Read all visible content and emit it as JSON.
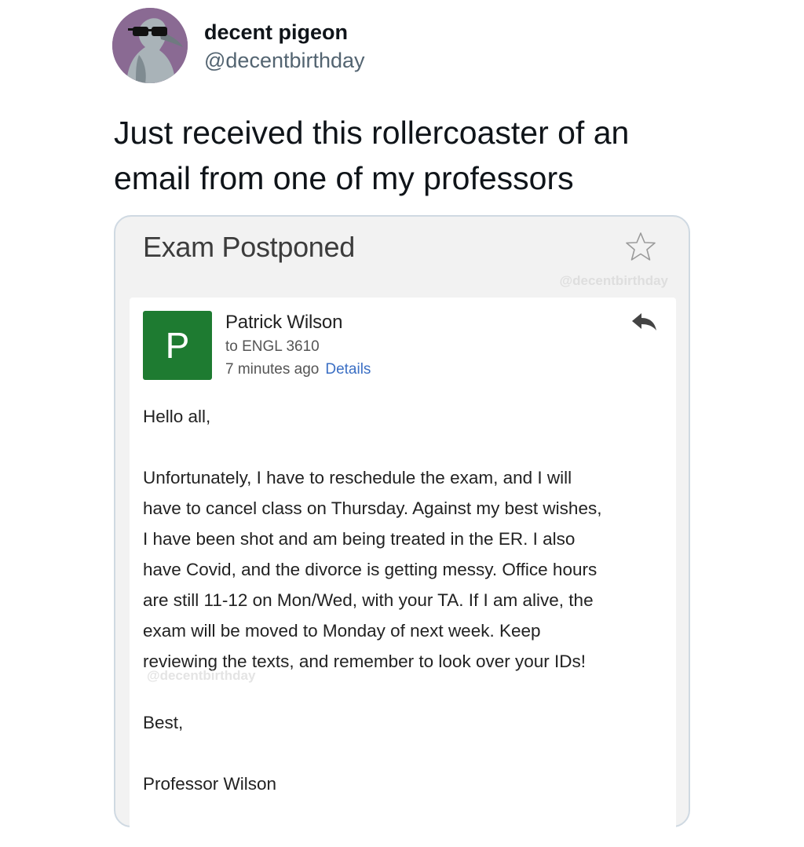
{
  "tweet": {
    "author_name": "decent pigeon",
    "author_handle": "@decentbirthday",
    "text_lines": [
      "Just received this rollercoaster of an",
      "email from one of my professors"
    ]
  },
  "email": {
    "subject": "Exam Postponed",
    "watermark": "@decentbirthday",
    "sender_initial": "P",
    "sender_name": "Patrick Wilson",
    "recipient": "to ENGL 3610",
    "time": "7 minutes ago",
    "details_label": "Details",
    "greeting": "Hello all,",
    "body_lines": [
      "Unfortunately, I have to reschedule the exam, and I will",
      "have to cancel class on Thursday. Against my best wishes,",
      "I have been shot and am being treated in the ER. I also",
      "have Covid, and the divorce is getting messy. Office hours",
      "are still 11-12 on Mon/Wed, with your TA. If I am alive, the",
      "exam will be moved to Monday of next week. Keep",
      "reviewing the texts, and remember to look over your IDs!"
    ],
    "sign_off": "Best,",
    "signature": "Professor Wilson"
  },
  "icons": {
    "star": "star-outline-icon",
    "reply": "reply-arrow-icon"
  },
  "colors": {
    "sender_avatar_bg": "#1e7b31",
    "link": "#3b6fc4",
    "avatar_bg": "#8a6a93"
  }
}
